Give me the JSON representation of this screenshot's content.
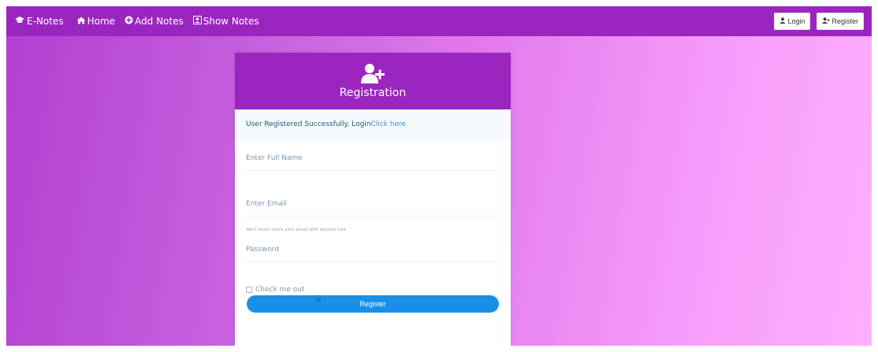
{
  "navbar": {
    "brand": "E-Notes",
    "links": [
      "Home",
      "Add Notes",
      "Show Notes"
    ],
    "login_label": "Login",
    "register_label": "Register",
    "bg_color": "#9b25bf"
  },
  "card": {
    "title": "Registration",
    "icon": "add-user-icon",
    "alert_text": "User Registered Successfully. Login",
    "alert_link": "Click here",
    "name_placeholder": "Enter Full Name",
    "email_placeholder": "Enter Email",
    "email_help": "We'll never share your email with anyone else.",
    "password_placeholder": "Password",
    "remember_label": "Check me out",
    "submit_label": "Register",
    "button_color": "#1a8fe8"
  }
}
